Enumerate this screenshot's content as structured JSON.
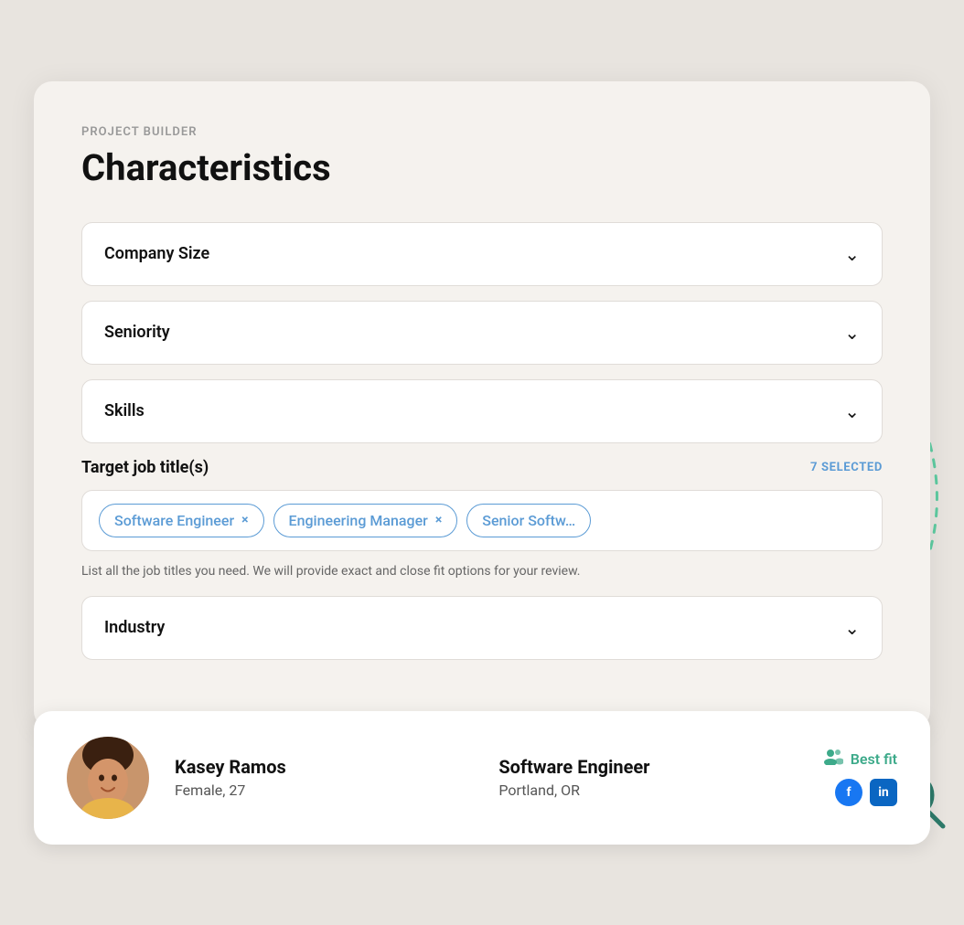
{
  "header": {
    "project_builder_label": "PROJECT BUILDER",
    "page_title": "Characteristics"
  },
  "accordions": [
    {
      "id": "company-size",
      "label": "Company Size"
    },
    {
      "id": "seniority",
      "label": "Seniority"
    },
    {
      "id": "skills",
      "label": "Skills"
    }
  ],
  "job_titles_section": {
    "label": "Target job title(s)",
    "selected_count": "7 SELECTED",
    "tags": [
      {
        "id": "tag-software-engineer",
        "text": "Software Engineer"
      },
      {
        "id": "tag-engineering-manager",
        "text": "Engineering Manager"
      },
      {
        "id": "tag-senior-softw",
        "text": "Senior Softw…"
      }
    ],
    "hint": "List all the job titles you need. We will provide exact and close fit options for your review."
  },
  "industry_accordion": {
    "label": "Industry"
  },
  "profile_card": {
    "name": "Kasey Ramos",
    "demographics": "Female, 27",
    "job_title": "Software Engineer",
    "location": "Portland, OR",
    "best_fit_label": "Best fit",
    "social": {
      "facebook_label": "f",
      "linkedin_label": "in"
    }
  },
  "icons": {
    "chevron": "∨",
    "close": "×"
  }
}
